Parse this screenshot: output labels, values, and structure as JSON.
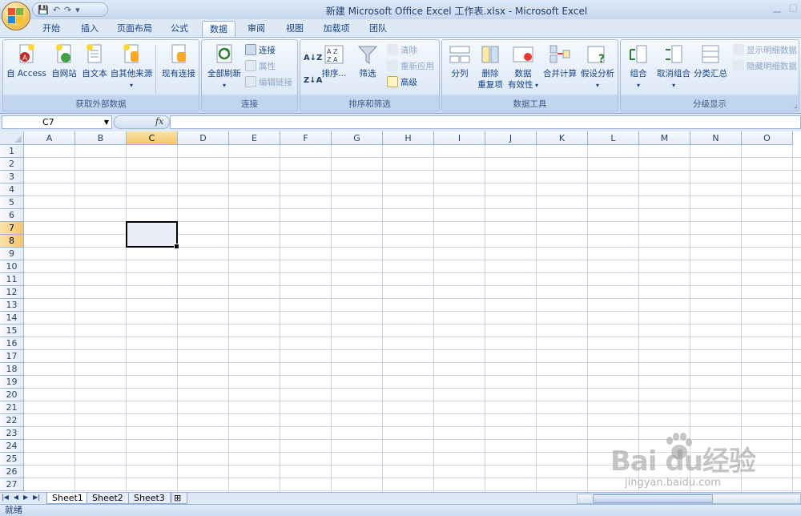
{
  "window": {
    "title": "新建 Microsoft Office Excel 工作表.xlsx - Microsoft Excel",
    "qat_items": [
      "save-icon",
      "undo-icon",
      "redo-icon",
      "customize-icon"
    ]
  },
  "tabs": [
    {
      "label": "开始"
    },
    {
      "label": "插入"
    },
    {
      "label": "页面布局"
    },
    {
      "label": "公式"
    },
    {
      "label": "数据",
      "active": true
    },
    {
      "label": "审阅"
    },
    {
      "label": "视图"
    },
    {
      "label": "加载项"
    },
    {
      "label": "团队"
    }
  ],
  "ribbon": {
    "get_external": {
      "label": "获取外部数据",
      "access": "自 Access",
      "web": "自网站",
      "text": "自文本",
      "other": "自其他来源",
      "existing": "现有连接"
    },
    "connections": {
      "label": "连接",
      "refresh_all": "全部刷新",
      "connections": "连接",
      "properties": "属性",
      "edit_links": "编辑链接"
    },
    "sort_filter": {
      "label": "排序和筛选",
      "sort": "排序...",
      "filter": "筛选",
      "clear": "清除",
      "reapply": "重新应用",
      "advanced": "高级"
    },
    "data_tools": {
      "label": "数据工具",
      "text_to_columns": "分列",
      "remove_dup_1": "删除",
      "remove_dup_2": "重复项",
      "validation_1": "数据",
      "validation_2": "有效性",
      "consolidate": "合并计算",
      "what_if": "假设分析"
    },
    "outline": {
      "label": "分级显示",
      "group": "组合",
      "ungroup": "取消组合",
      "subtotal": "分类汇总",
      "show_detail": "显示明细数据",
      "hide_detail": "隐藏明细数据"
    }
  },
  "formula_bar": {
    "name_box": "C7",
    "fx": "fx",
    "content": ""
  },
  "columns": [
    "A",
    "B",
    "C",
    "D",
    "E",
    "F",
    "G",
    "H",
    "I",
    "J",
    "K",
    "L",
    "M",
    "N",
    "O"
  ],
  "selected_column": "C",
  "rows": [
    "1",
    "2",
    "3",
    "4",
    "5",
    "6",
    "7",
    "8",
    "9",
    "10",
    "11",
    "12",
    "13",
    "14",
    "15",
    "16",
    "17",
    "18",
    "19",
    "20",
    "21",
    "22",
    "23",
    "24",
    "25",
    "26",
    "27"
  ],
  "selected_rows": [
    "7",
    "8"
  ],
  "sheets": [
    {
      "label": "Sheet1",
      "active": true
    },
    {
      "label": "Sheet2"
    },
    {
      "label": "Sheet3"
    }
  ],
  "status": "就绪",
  "watermark": {
    "brand": "Bai du经验",
    "url": "jingyan.baidu.com"
  }
}
